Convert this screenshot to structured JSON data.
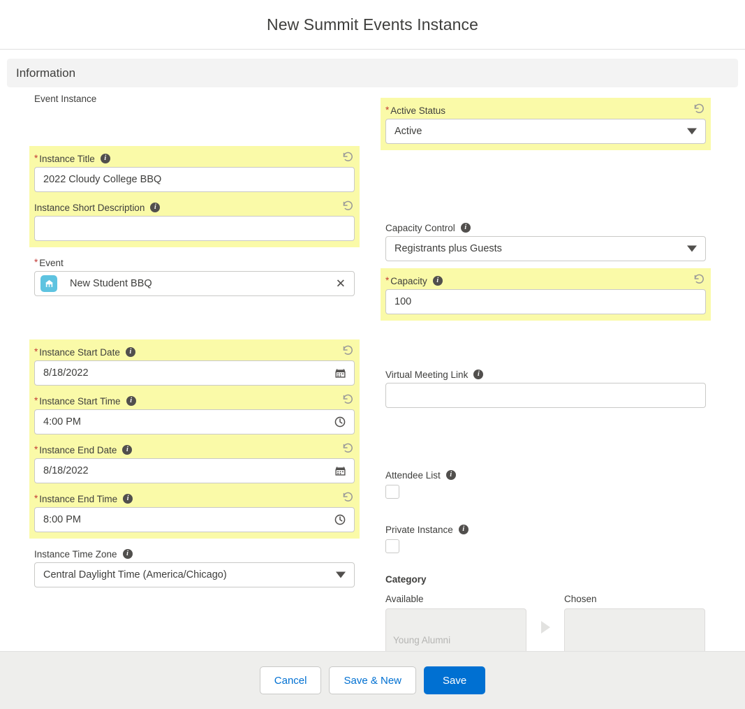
{
  "modal": {
    "title": "New Summit Events Instance"
  },
  "section": {
    "label": "Information"
  },
  "left": {
    "subgroup_title": "Event Instance",
    "instance_title": {
      "label": "Instance Title",
      "required": "*",
      "value": "2022 Cloudy College BBQ",
      "info_icon": "info-icon",
      "undo_icon": "undo-icon",
      "highlighted": true
    },
    "instance_short_description": {
      "label": "Instance Short Description",
      "value": "",
      "info_icon": "info-icon",
      "undo_icon": "undo-icon",
      "highlighted": true
    },
    "event": {
      "label": "Event",
      "required": "*",
      "value": "New Student BBQ",
      "avatar_icon": "event-tent-icon",
      "clear_icon": "close-icon",
      "highlighted": false
    },
    "instance_start_date": {
      "label": "Instance Start Date",
      "required": "*",
      "value": "8/18/2022",
      "info_icon": "info-icon",
      "undo_icon": "undo-icon",
      "trailing_icon": "calendar-icon",
      "highlighted": true
    },
    "instance_start_time": {
      "label": "Instance Start Time",
      "required": "*",
      "value": "4:00 PM",
      "info_icon": "info-icon",
      "undo_icon": "undo-icon",
      "trailing_icon": "clock-icon",
      "highlighted": true
    },
    "instance_end_date": {
      "label": "Instance End Date",
      "required": "*",
      "value": "8/18/2022",
      "info_icon": "info-icon",
      "undo_icon": "undo-icon",
      "trailing_icon": "calendar-icon",
      "highlighted": true
    },
    "instance_end_time": {
      "label": "Instance End Time",
      "required": "*",
      "value": "8:00 PM",
      "info_icon": "info-icon",
      "undo_icon": "undo-icon",
      "trailing_icon": "clock-icon",
      "highlighted": true
    },
    "instance_time_zone": {
      "label": "Instance Time Zone",
      "value": "Central Daylight Time (America/Chicago)",
      "info_icon": "info-icon",
      "caret_icon": "chevron-down-icon",
      "highlighted": false
    }
  },
  "right": {
    "active_status": {
      "label": "Active Status",
      "required": "*",
      "value": "Active",
      "undo_icon": "undo-icon",
      "caret_icon": "chevron-down-icon",
      "highlighted": true
    },
    "capacity_control": {
      "label": "Capacity Control",
      "value": "Registrants plus Guests",
      "info_icon": "info-icon",
      "caret_icon": "chevron-down-icon",
      "highlighted": false
    },
    "capacity": {
      "label": "Capacity",
      "required": "*",
      "value": "100",
      "info_icon": "info-icon",
      "undo_icon": "undo-icon",
      "highlighted": true
    },
    "virtual_meeting_link": {
      "label": "Virtual Meeting Link",
      "value": "",
      "info_icon": "info-icon",
      "highlighted": false
    },
    "attendee_list": {
      "label": "Attendee List",
      "info_icon": "info-icon",
      "checked": false
    },
    "private_instance": {
      "label": "Private Instance",
      "info_icon": "info-icon",
      "checked": false
    },
    "category": {
      "title": "Category",
      "available_label": "Available",
      "chosen_label": "Chosen",
      "move_right_icon": "arrow-right-icon",
      "available_items": [
        "Young Alumni"
      ],
      "chosen_items": []
    }
  },
  "footer": {
    "cancel_label": "Cancel",
    "save_new_label": "Save & New",
    "save_label": "Save"
  },
  "colors": {
    "highlight_yellow": "#fafaa8",
    "brand_blue": "#0070d2",
    "required_red": "#c23934",
    "text_dark": "#3e3e3c",
    "lookup_avatar_blue": "#5ec3e0",
    "band_gray": "#f3f3f3",
    "footer_gray": "#eeeeec"
  }
}
